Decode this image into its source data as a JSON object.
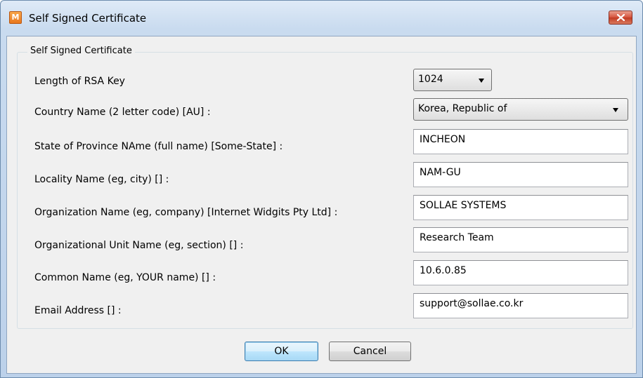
{
  "window": {
    "title": "Self Signed Certificate",
    "icon_letter": "M",
    "icon": "app-m-icon",
    "close_icon": "close-icon"
  },
  "group": {
    "title": "Self Signed Certificate"
  },
  "fields": {
    "rsa_key": {
      "label": "Length of RSA Key",
      "value": "1024"
    },
    "country": {
      "label": "Country Name (2 letter code) [AU] :",
      "value": "Korea, Republic of"
    },
    "state": {
      "label": "State of Province NAme (full name) [Some-State] :",
      "value": "INCHEON"
    },
    "locality": {
      "label": "Locality Name (eg, city) [] :",
      "value": "NAM-GU"
    },
    "organization": {
      "label": "Organization Name (eg, company) [Internet Widgits Pty Ltd] :",
      "value": "SOLLAE SYSTEMS"
    },
    "org_unit": {
      "label": "Organizational Unit Name (eg, section) [] :",
      "value": "Research Team"
    },
    "common_name": {
      "label": "Common Name (eg, YOUR name) [] :",
      "value": "10.6.0.85"
    },
    "email": {
      "label": "Email Address [] :",
      "value": "support@sollae.co.kr"
    }
  },
  "buttons": {
    "ok": "OK",
    "cancel": "Cancel"
  },
  "colors": {
    "close_button": "#c13b23",
    "default_button_border": "#3c7fb1",
    "title_bar": "#c9dbef"
  }
}
